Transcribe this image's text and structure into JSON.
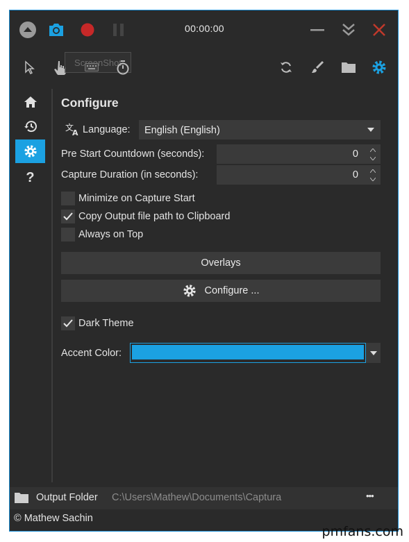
{
  "titlebar": {
    "timer": "00:00:00"
  },
  "toolbar": {
    "tooltip": "ScreenShot"
  },
  "page": {
    "title": "Configure",
    "language_label": "Language:",
    "language_value": "English (English)",
    "countdown_label": "Pre Start Countdown (seconds):",
    "countdown_value": "0",
    "duration_label": "Capture Duration (in seconds):",
    "duration_value": "0",
    "options": [
      {
        "label": "Minimize on Capture Start",
        "checked": false
      },
      {
        "label": "Copy Output file path to Clipboard",
        "checked": true
      },
      {
        "label": "Always on Top",
        "checked": false
      }
    ],
    "overlays_button": "Overlays",
    "configure_button": "Configure ...",
    "dark_theme_label": "Dark Theme",
    "dark_theme_checked": true,
    "accent_label": "Accent Color:",
    "accent_color": "#1ba1e2"
  },
  "footer": {
    "output_label": "Output Folder",
    "output_path": "C:\\Users\\Mathew\\Documents\\Captura",
    "more": "•••",
    "copyright": "© Mathew Sachin"
  },
  "watermark": "pmfans.com",
  "colors": {
    "accent": "#1ba1e2",
    "record": "#d32f2f",
    "close": "#c0392b",
    "window_bg": "#2a2a2a"
  },
  "icons": [
    "collapse-up-icon",
    "camera-icon",
    "record-icon",
    "pause-icon",
    "minimize-icon",
    "chevrons-down-icon",
    "close-icon",
    "pointer-icon",
    "hand-icon",
    "keyboard-icon",
    "timer-icon",
    "refresh-icon",
    "brush-icon",
    "folder-icon",
    "gear-icon",
    "home-icon",
    "history-icon",
    "settings-icon",
    "help-icon",
    "translate-icon",
    "folder-icon"
  ]
}
